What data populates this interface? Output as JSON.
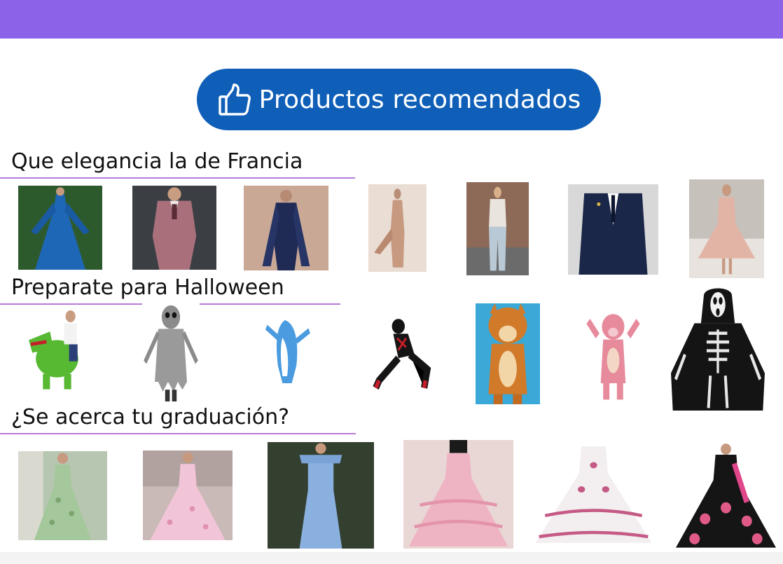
{
  "header": {
    "bar_color": "#8c62e8"
  },
  "recommended": {
    "label": "Productos recomendados",
    "icon": "thumbs-up-icon",
    "color": "#0f5fb8"
  },
  "sections": [
    {
      "title": "Que elegancia la de Francia",
      "products": [
        {
          "name": "product-blue-pleated-gown",
          "bg": "#2d5a2d",
          "fg": "#1e67b6"
        },
        {
          "name": "product-mauve-suit",
          "bg": "#3b3f44",
          "fg": "#a9707b"
        },
        {
          "name": "product-navy-jumpsuit",
          "bg": "#c9a896",
          "fg": "#1f2a55"
        },
        {
          "name": "product-nude-gown",
          "bg": "#e9ddd4",
          "fg": "#c79a80"
        },
        {
          "name": "product-jeans-outfit",
          "bg": "#8d6a58",
          "fg": "#b9c9d6"
        },
        {
          "name": "product-navy-suit",
          "bg": "#d8d8d8",
          "fg": "#1b2748"
        },
        {
          "name": "product-pink-short-dress",
          "bg": "#c7c1bb",
          "fg": "#e2b4a6"
        }
      ]
    },
    {
      "title": "Preparate para Halloween",
      "products": [
        {
          "name": "product-dinosaur-costume",
          "bg": "#ffffff",
          "fg": "#57b832"
        },
        {
          "name": "product-ghoul-costume",
          "bg": "#ffffff",
          "fg": "#8b8b8b"
        },
        {
          "name": "product-shark-costume",
          "bg": "#ffffff",
          "fg": "#4a9be0"
        },
        {
          "name": "product-spider-costume",
          "bg": "#ffffff",
          "fg": "#c61e2a"
        },
        {
          "name": "product-fox-mascot",
          "bg": "#3aa9d8",
          "fg": "#d07a2a"
        },
        {
          "name": "product-pink-panther-mascot",
          "bg": "#ffffff",
          "fg": "#e68a9c"
        },
        {
          "name": "product-skeleton-costume",
          "bg": "#ffffff",
          "fg": "#141414"
        }
      ]
    },
    {
      "title": "¿Se acerca tu graduación?",
      "products": [
        {
          "name": "product-green-floral-gown",
          "bg": "#b7c6b0",
          "fg": "#a4c89b"
        },
        {
          "name": "product-pink-ball-gown",
          "bg": "#c9b9b7",
          "fg": "#f1c5d7"
        },
        {
          "name": "product-light-blue-gown",
          "bg": "#33402f",
          "fg": "#8ab0e0"
        },
        {
          "name": "product-pink-quinceanera",
          "bg": "#e8d7d4",
          "fg": "#efb4c3"
        },
        {
          "name": "product-white-embroidered-quince",
          "bg": "#ffffff",
          "fg": "#f3eff0"
        },
        {
          "name": "product-black-floral-quince",
          "bg": "#ffffff",
          "fg": "#151515"
        }
      ]
    }
  ]
}
